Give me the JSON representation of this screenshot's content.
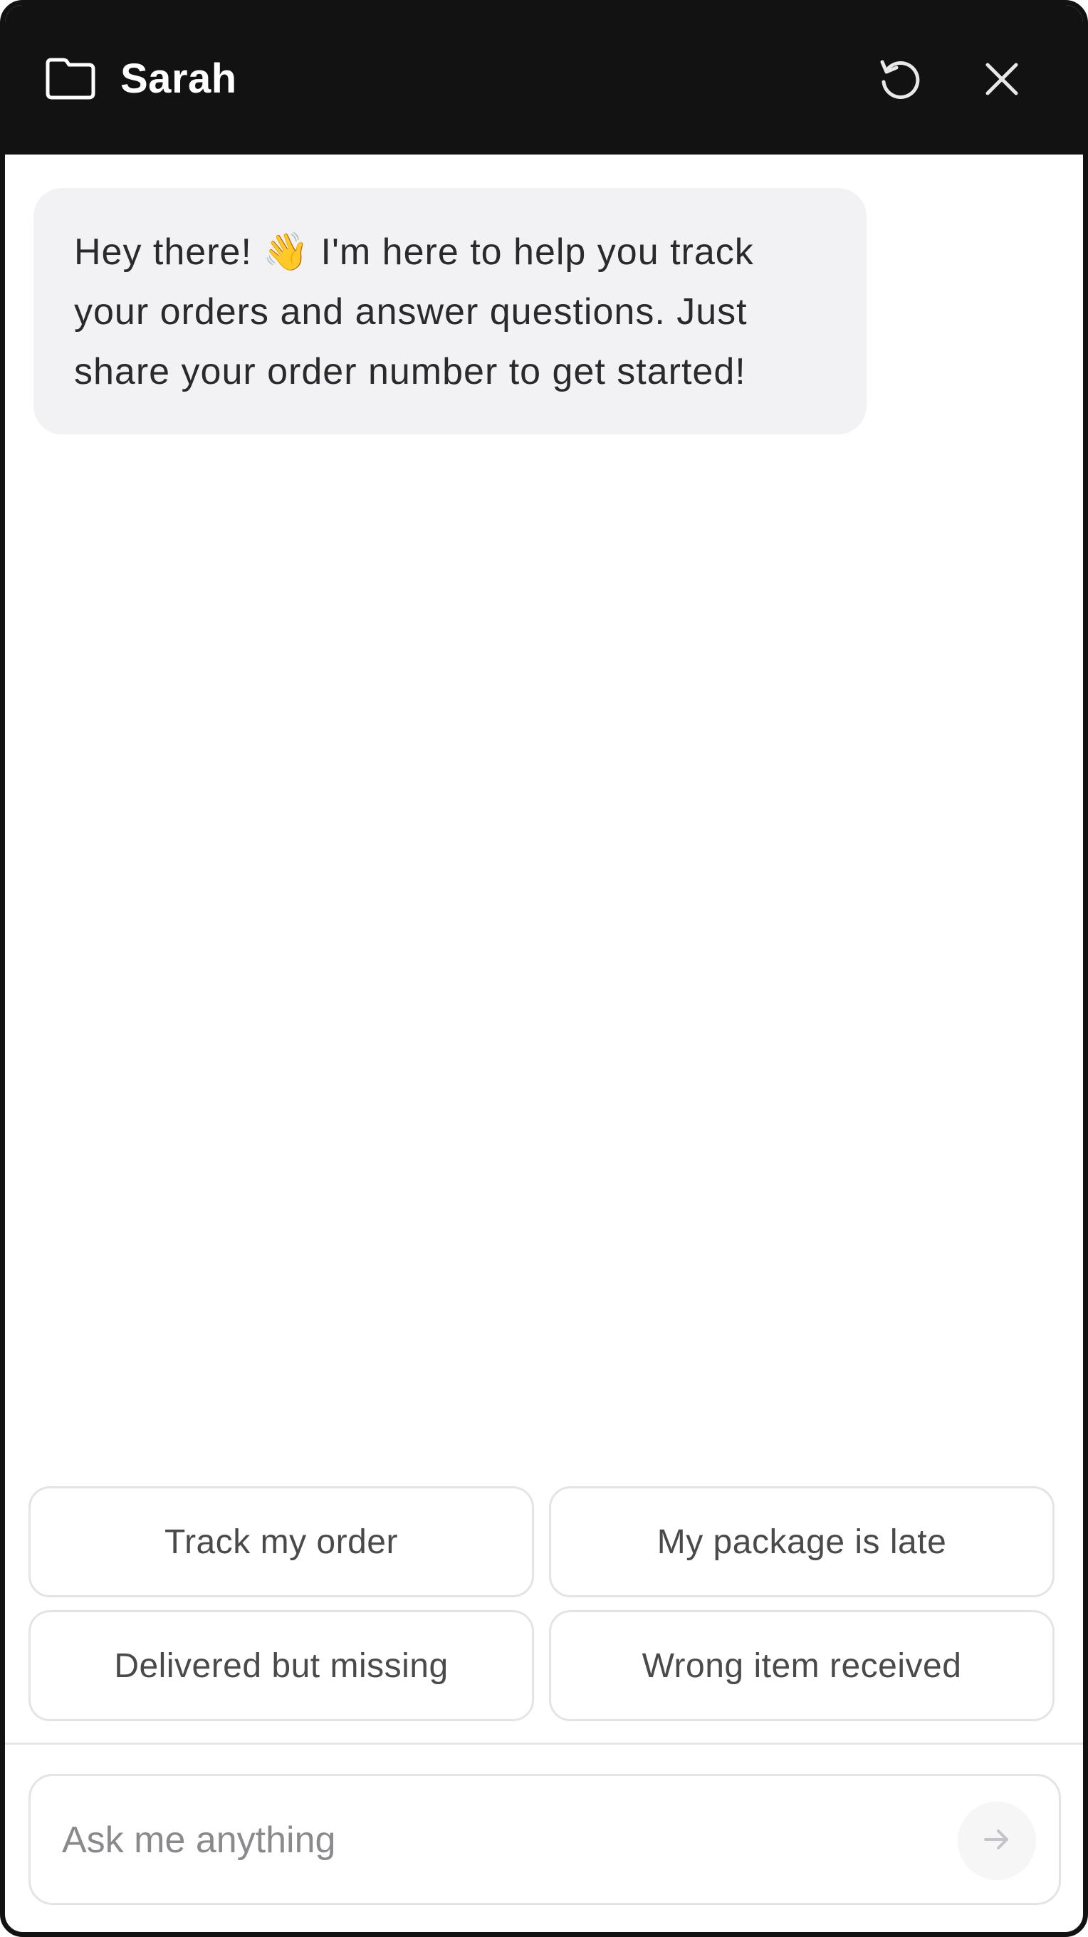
{
  "header": {
    "title": "Sarah",
    "folder_icon": "folder-icon",
    "refresh_icon": "refresh-icon",
    "close_icon": "close-icon",
    "background": "#121212"
  },
  "messages": [
    {
      "sender": "bot",
      "text_before": "Hey there! ",
      "emoji": "👋",
      "text_after": " I'm here to help you track your orders and answer questions. Just share your order number to get started!"
    }
  ],
  "suggestions": [
    {
      "label": "Track my order"
    },
    {
      "label": "My package is late"
    },
    {
      "label": "Delivered but missing"
    },
    {
      "label": "Wrong item received"
    }
  ],
  "composer": {
    "placeholder": "Ask me anything",
    "value": "",
    "send_icon": "arrow-right-icon"
  }
}
